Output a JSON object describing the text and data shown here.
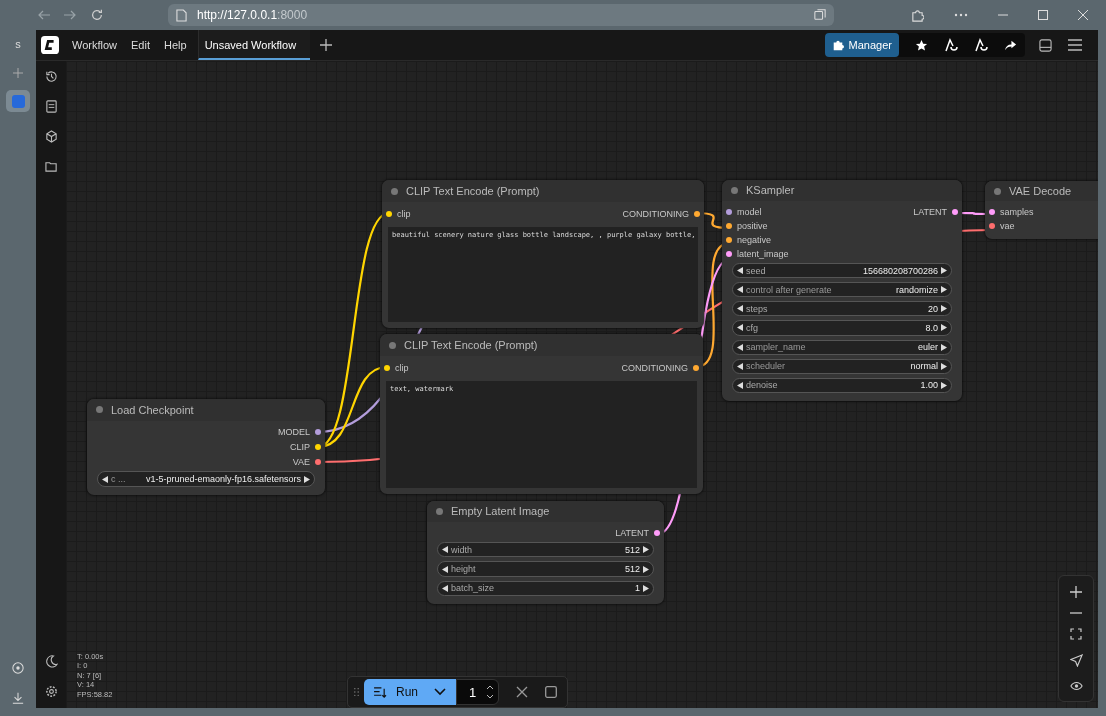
{
  "browser": {
    "url_host": "http://127.0.0.1",
    "url_port": ":8000",
    "profile": "s"
  },
  "menu": [
    "Workflow",
    "Edit",
    "Help"
  ],
  "tabs": [
    {
      "label": "Unsaved Workflow",
      "selected": true
    }
  ],
  "manager_button": "Manager",
  "nodes": [
    {
      "title": "CLIP Text Encode (Prompt)",
      "inputs": [
        {
          "name": "clip",
          "color": "#ffd500"
        }
      ],
      "outputs": [
        {
          "name": "CONDITIONING",
          "color": "#ffa931"
        }
      ],
      "widgets": [
        {
          "kind": "text",
          "value": "beautiful scenery nature glass bottle landscape, , purple galaxy bottle,"
        }
      ]
    },
    {
      "title": "KSampler",
      "inputs": [
        {
          "name": "model",
          "color": "#b39ddb"
        },
        {
          "name": "positive",
          "color": "#ffa931"
        },
        {
          "name": "negative",
          "color": "#ffa931"
        },
        {
          "name": "latent_image",
          "color": "#ff9cf9"
        }
      ],
      "outputs": [
        {
          "name": "LATENT",
          "color": "#ff9cf9"
        }
      ],
      "widgets": [
        {
          "kind": "number",
          "label": "seed",
          "value": "156680208700286"
        },
        {
          "kind": "combo",
          "label": "control after generate",
          "value": "randomize"
        },
        {
          "kind": "number",
          "label": "steps",
          "value": "20"
        },
        {
          "kind": "number",
          "label": "cfg",
          "value": "8.0"
        },
        {
          "kind": "combo",
          "label": "sampler_name",
          "value": "euler"
        },
        {
          "kind": "combo",
          "label": "scheduler",
          "value": "normal"
        },
        {
          "kind": "number",
          "label": "denoise",
          "value": "1.00"
        }
      ]
    },
    {
      "title": "VAE Decode",
      "inputs": [
        {
          "name": "samples",
          "color": "#ff9cf9"
        },
        {
          "name": "vae",
          "color": "#ff6e6e"
        }
      ]
    },
    {
      "title": "CLIP Text Encode (Prompt)",
      "inputs": [
        {
          "name": "clip",
          "color": "#ffd500"
        }
      ],
      "outputs": [
        {
          "name": "CONDITIONING",
          "color": "#ffa931"
        }
      ],
      "widgets": [
        {
          "kind": "text",
          "value": "text, watermark"
        }
      ]
    },
    {
      "title": "Load Checkpoint",
      "outputs": [
        {
          "name": "MODEL",
          "color": "#b39ddb"
        },
        {
          "name": "CLIP",
          "color": "#ffd500"
        },
        {
          "name": "VAE",
          "color": "#ff6e6e"
        }
      ],
      "widgets": [
        {
          "kind": "combo",
          "label": "c ...",
          "value": "v1-5-pruned-emaonly-fp16.safetensors"
        }
      ]
    },
    {
      "title": "Empty Latent Image",
      "outputs": [
        {
          "name": "LATENT",
          "color": "#ff9cf9"
        }
      ],
      "widgets": [
        {
          "kind": "number",
          "label": "width",
          "value": "512"
        },
        {
          "kind": "number",
          "label": "height",
          "value": "512"
        },
        {
          "kind": "number",
          "label": "batch_size",
          "value": "1"
        }
      ]
    }
  ],
  "stats": [
    "T: 0.00s",
    "I: 0",
    "N: 7 [6]",
    "V: 14",
    "FPS:58.82"
  ],
  "run_bar": {
    "label": "Run",
    "count": "1"
  }
}
